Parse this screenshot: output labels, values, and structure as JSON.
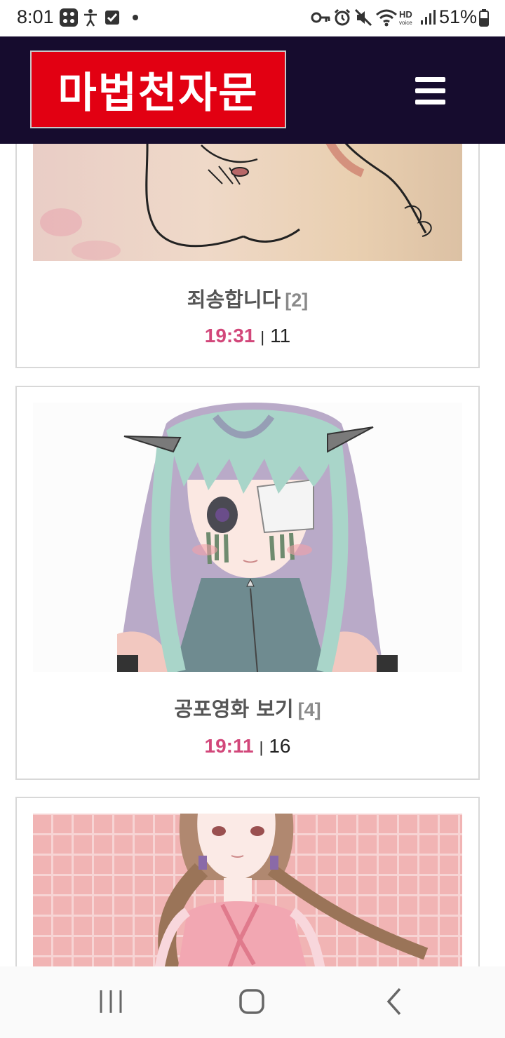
{
  "status_bar": {
    "time": "8:01",
    "battery": "51%",
    "icons": [
      "gallery-app-icon",
      "accessibility-icon",
      "checkbox-icon",
      "dot-icon",
      "key-icon",
      "alarm-icon",
      "mute-icon",
      "wifi-icon",
      "hd-voice-icon",
      "signal-icon",
      "battery-icon"
    ]
  },
  "header": {
    "logo_text": "마법천자문",
    "logo_color": "#e20012",
    "background": "#160c2e",
    "menu_icon": "hamburger-menu-icon"
  },
  "posts": [
    {
      "title": "죄송합니다",
      "comments": "[2]",
      "time": "19:31",
      "views": "11"
    },
    {
      "title": "공포영화 보기",
      "comments": "[4]",
      "time": "19:11",
      "views": "16"
    },
    {
      "title": "",
      "comments": "",
      "time": "",
      "views": ""
    }
  ],
  "meta_separator": "|",
  "nav_bar": {
    "recent_icon": "recent-apps-icon",
    "home_icon": "home-icon",
    "back_icon": "back-icon"
  },
  "colors": {
    "accent_time": "#d2477a",
    "title_text": "#555555",
    "comment_count": "#8a8a8a"
  }
}
